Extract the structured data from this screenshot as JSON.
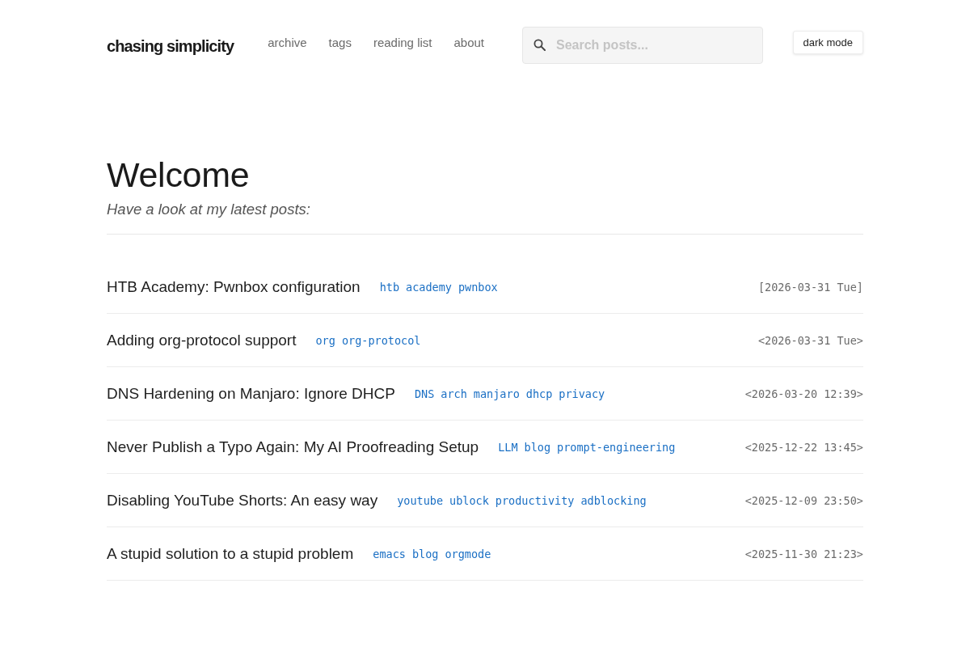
{
  "site": {
    "title": "chasing simplicity"
  },
  "nav": [
    {
      "label": "archive"
    },
    {
      "label": "tags"
    },
    {
      "label": "reading list"
    },
    {
      "label": "about"
    }
  ],
  "search": {
    "placeholder": "Search posts..."
  },
  "theme_button": {
    "label": "dark mode"
  },
  "intro": {
    "heading": "Welcome",
    "subtitle": "Have a look at my latest posts:"
  },
  "posts": [
    {
      "title": "HTB Academy: Pwnbox configuration",
      "tags": [
        "htb",
        "academy",
        "pwnbox"
      ],
      "date": "[2026-03-31 Tue]"
    },
    {
      "title": "Adding org-protocol support",
      "tags": [
        "org",
        "org-protocol"
      ],
      "date": "<2026-03-31 Tue>"
    },
    {
      "title": "DNS Hardening on Manjaro: Ignore DHCP",
      "tags": [
        "DNS",
        "arch",
        "manjaro",
        "dhcp",
        "privacy"
      ],
      "date": "<2026-03-20 12:39>"
    },
    {
      "title": "Never Publish a Typo Again: My AI Proofreading Setup",
      "tags": [
        "LLM",
        "blog",
        "prompt-engineering"
      ],
      "date": "<2025-12-22 13:45>"
    },
    {
      "title": "Disabling YouTube Shorts: An easy way",
      "tags": [
        "youtube",
        "ublock",
        "productivity",
        "adblocking"
      ],
      "date": "<2025-12-09 23:50>"
    },
    {
      "title": "A stupid solution to a stupid problem",
      "tags": [
        "emacs",
        "blog",
        "orgmode"
      ],
      "date": "<2025-11-30 21:23>"
    }
  ]
}
